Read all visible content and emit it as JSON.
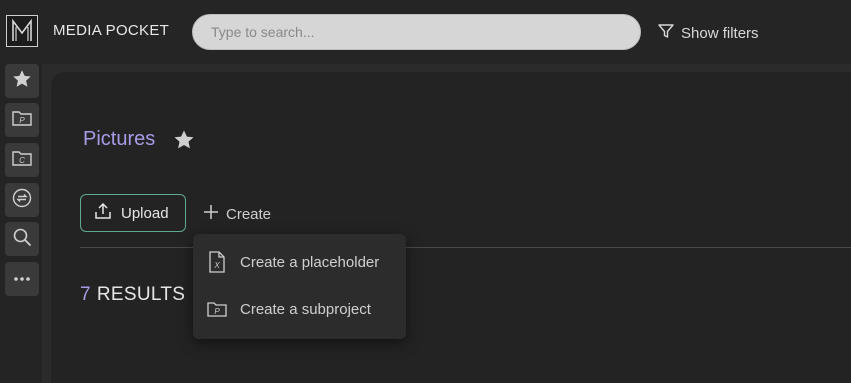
{
  "header": {
    "brand": "MEDIA POCKET",
    "search_placeholder": "Type to search...",
    "filters_label": "Show filters"
  },
  "sidebar": {
    "items": [
      {
        "icon": "star-icon"
      },
      {
        "icon": "project-folder-icon"
      },
      {
        "icon": "collection-folder-icon"
      },
      {
        "icon": "sync-icon"
      },
      {
        "icon": "search-icon"
      },
      {
        "icon": "more-icon"
      }
    ]
  },
  "page": {
    "title": "Pictures",
    "upload_label": "Upload",
    "create_label": "Create",
    "results_count": "7",
    "results_label": "RESULTS"
  },
  "create_menu": {
    "items": [
      {
        "label": "Create a placeholder",
        "icon": "placeholder-file-icon"
      },
      {
        "label": "Create a subproject",
        "icon": "subproject-folder-icon"
      }
    ]
  },
  "colors": {
    "accent": "#a79be6",
    "upload_border": "#5fa893"
  }
}
